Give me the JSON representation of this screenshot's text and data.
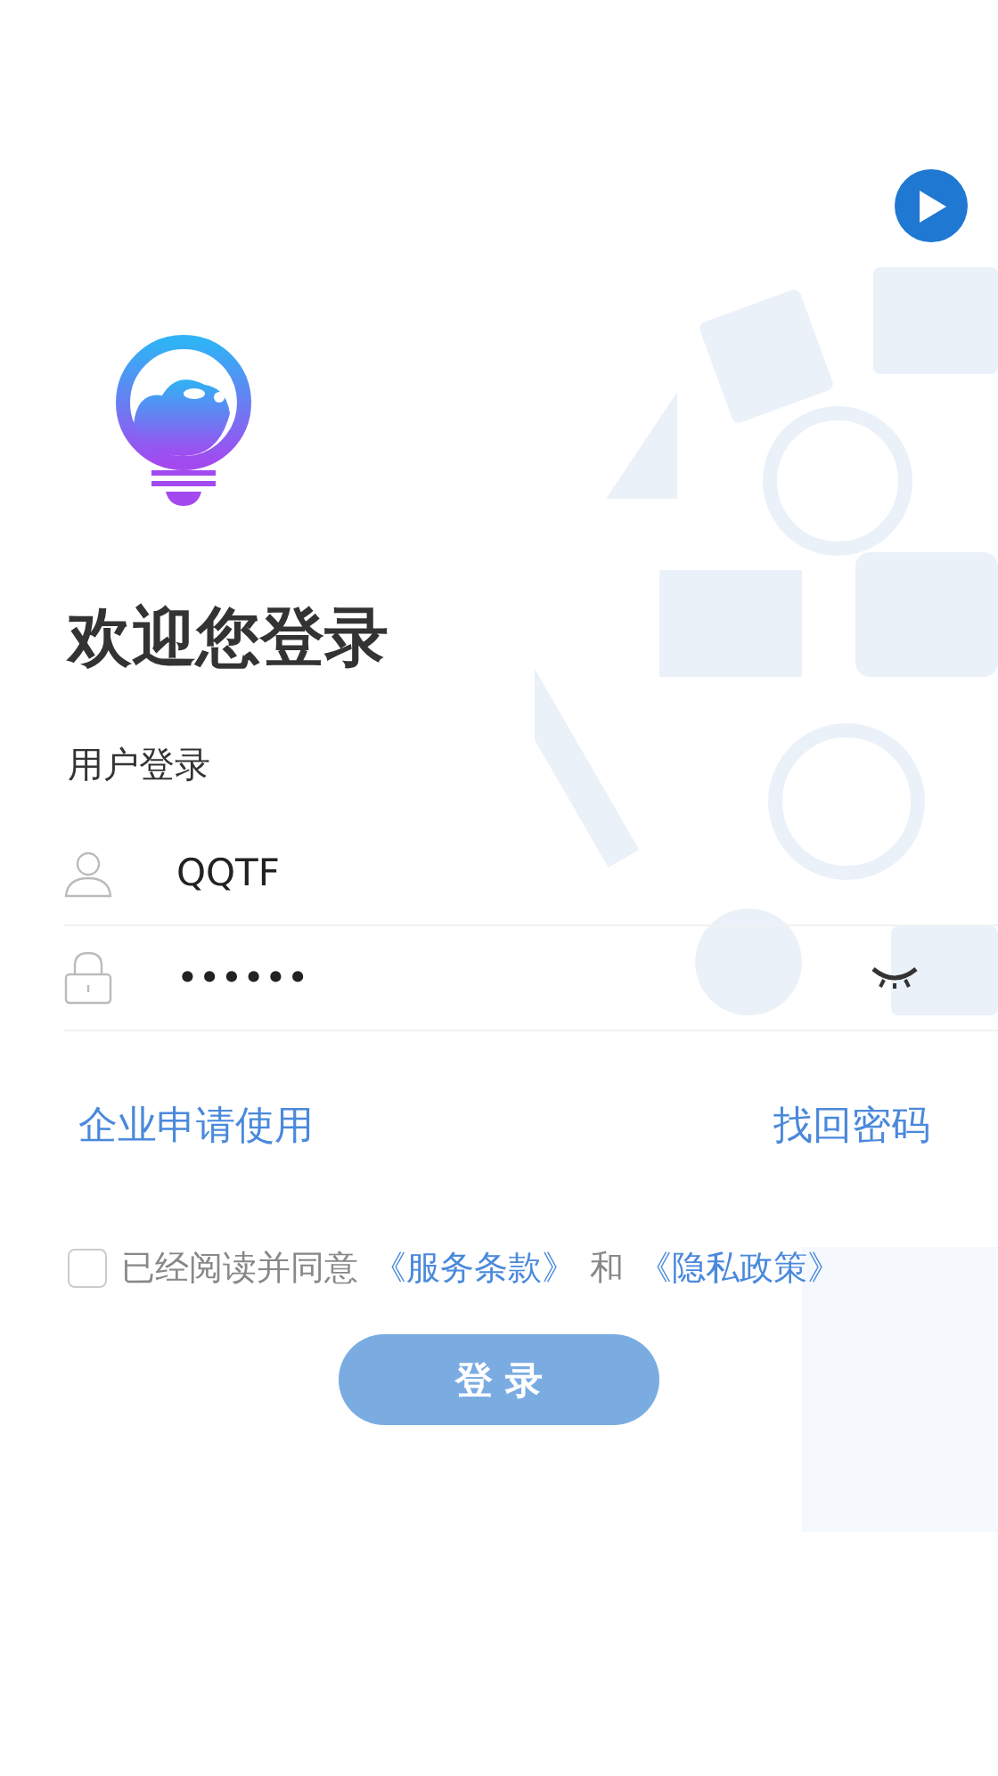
{
  "title": "欢迎您登录",
  "subtitle": "用户登录",
  "username": {
    "value": "QQTF"
  },
  "password": {
    "value": "••••••"
  },
  "links": [
    {
      "label": "企业申请使用"
    },
    {
      "label": "找回密码"
    }
  ],
  "agreement": {
    "checked": false,
    "parts": [
      {
        "kind": "text",
        "text": "已经阅读并同意"
      },
      {
        "kind": "link",
        "text": "《服务条款》"
      },
      {
        "kind": "text",
        "text": "和"
      },
      {
        "kind": "link",
        "text": "《隐私政策》"
      }
    ]
  },
  "login_button": {
    "label": "登 录"
  }
}
